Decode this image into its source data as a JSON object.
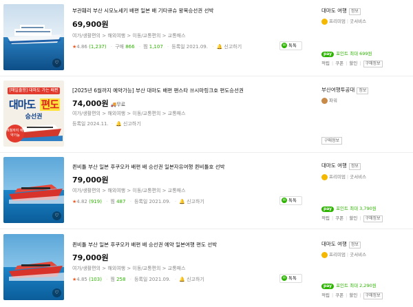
{
  "items": [
    {
      "title": "부관훼리 부산 시모노세키 배편 일본 배 기타큐슈 왕복승선권 선박",
      "price": "69,900원",
      "shipping": "",
      "category": [
        "여가/생활편의",
        "해외여행",
        "이동/교통편의",
        "교통패스"
      ],
      "rating": "4.86",
      "reviews": "(1,237)",
      "purchases_label": "구매",
      "purchases": "866",
      "wishes_label": "찜",
      "wishes": "1,107",
      "registered": "등록일 2021.09.",
      "report": "신고하기",
      "talk": "톡톡",
      "seller": "대마도 여행",
      "seller_info": "정보",
      "grade": "프리미엄",
      "service": "굿서비스",
      "npay_label": "pay",
      "point_text": "포인트 최대 699원",
      "links": [
        "적립",
        "쿠폰",
        "할인",
        "구매정보"
      ]
    },
    {
      "title": "[2025년 6월까지 예약가능] 부산 대마도 배편 팬스타 쓰시마링크호 편도승선권",
      "price": "74,000원",
      "shipping": "무료",
      "category": [
        "여가/생활편의",
        "해외여행",
        "이동/교통편의",
        "교통패스"
      ],
      "registered": "등록일 2024.11.",
      "report": "신고하기",
      "seller": "부산여행투공대",
      "seller_info": "정보",
      "grade": "파워",
      "buy_info": "구매정보",
      "promo": {
        "badge": "[매일출항] 대마도 가는 배편",
        "main_a": "대마도",
        "main_b": "편도",
        "sub": "승선권",
        "stamp": "6월까지 예약가능"
      }
    },
    {
      "title": "퀸비틀 부산 일본 후쿠오카 배편 배 승선권 일본자유여행 퀸비틀호 선박",
      "price": "79,000원",
      "shipping": "",
      "category": [
        "여가/생활편의",
        "해외여행",
        "이동/교통편의",
        "교통패스"
      ],
      "rating": "4.82",
      "reviews": "(919)",
      "wishes_label": "찜",
      "wishes": "487",
      "registered": "등록일 2021.09.",
      "report": "신고하기",
      "talk": "톡톡",
      "seller": "대마도 여행",
      "seller_info": "정보",
      "grade": "프리미엄",
      "service": "굿서비스",
      "npay_label": "pay",
      "point_text": "포인트 최대 3,790원",
      "links": [
        "적립",
        "쿠폰",
        "할인",
        "구매정보"
      ]
    },
    {
      "title": "퀸비틀 부산 일본 후쿠오카 배편 배 승선권 예약 일본여행 편도 선박",
      "price": "79,000원",
      "shipping": "",
      "category": [
        "여가/생활편의",
        "해외여행",
        "이동/교통편의",
        "교통패스"
      ],
      "rating": "4.85",
      "reviews": "(103)",
      "wishes_label": "찜",
      "wishes": "258",
      "registered": "등록일 2021.09.",
      "report": "신고하기",
      "talk": "톡톡",
      "seller": "대마도 여행",
      "seller_info": "정보",
      "grade": "프리미엄",
      "service": "굿서비스",
      "npay_label": "pay",
      "point_text": "포인트 최대 2,290원",
      "links": [
        "적립",
        "쿠폰",
        "할인",
        "구매정보"
      ]
    }
  ],
  "colors": {
    "accent": "#2db400",
    "star": "#f05a24",
    "promo_red": "#e23b2e"
  },
  "icons": {
    "heart": "heart-icon",
    "talk": "chat-icon",
    "report": "bell-icon",
    "medal": "medal-icon",
    "truck": "truck-icon"
  }
}
